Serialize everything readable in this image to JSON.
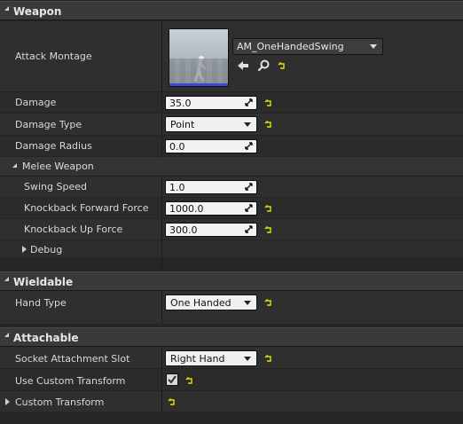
{
  "categories": {
    "weapon": "Weapon",
    "wieldable": "Wieldable",
    "attachable": "Attachable"
  },
  "weapon": {
    "attack_montage_label": "Attack Montage",
    "attack_montage_value": "AM_OneHandedSwing",
    "damage_label": "Damage",
    "damage_value": "35.0",
    "damage_type_label": "Damage Type",
    "damage_type_value": "Point",
    "damage_radius_label": "Damage Radius",
    "damage_radius_value": "0.0",
    "melee": {
      "title": "Melee Weapon",
      "swing_speed_label": "Swing Speed",
      "swing_speed_value": "1.0",
      "knockback_forward_label": "Knockback Forward Force",
      "knockback_forward_value": "1000.0",
      "knockback_up_label": "Knockback Up Force",
      "knockback_up_value": "300.0"
    },
    "debug_label": "Debug"
  },
  "wieldable": {
    "hand_type_label": "Hand Type",
    "hand_type_value": "One Handed"
  },
  "attachable": {
    "socket_label": "Socket Attachment Slot",
    "socket_value": "Right Hand",
    "use_custom_label": "Use Custom Transform",
    "use_custom_checked": true,
    "custom_transform_label": "Custom Transform"
  },
  "colors": {
    "reset_arrow": "#e6e000",
    "thumbnail_bar": "#3b46d6"
  }
}
